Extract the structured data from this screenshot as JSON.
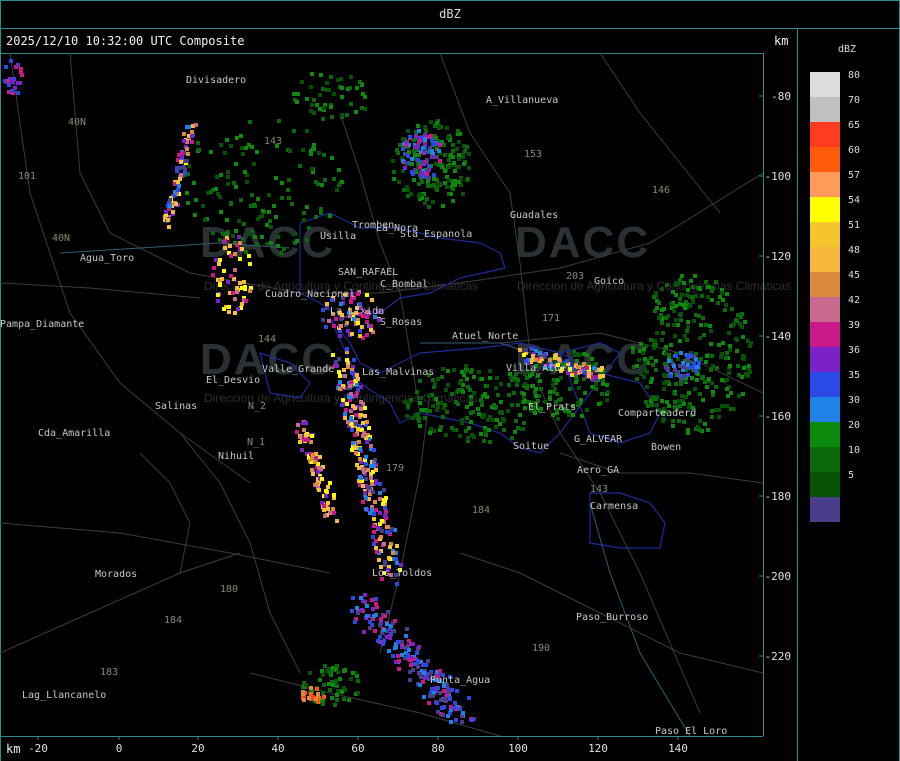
{
  "header": {
    "title": "dBZ"
  },
  "timestamp": "2025/12/10 10:32:00 UTC Composite",
  "units": {
    "top_right": "km",
    "bottom_left": "km"
  },
  "legend": {
    "title": "dBZ",
    "items": [
      {
        "value": "80",
        "color": "#dcdcdc"
      },
      {
        "value": "70",
        "color": "#c0c0c0"
      },
      {
        "value": "65",
        "color": "#ff3b1f"
      },
      {
        "value": "60",
        "color": "#ff5a0a"
      },
      {
        "value": "57",
        "color": "#ff9a5a"
      },
      {
        "value": "54",
        "color": "#ffff00"
      },
      {
        "value": "51",
        "color": "#f5c52e"
      },
      {
        "value": "48",
        "color": "#f5b83a"
      },
      {
        "value": "45",
        "color": "#d98a3a"
      },
      {
        "value": "42",
        "color": "#c86a90"
      },
      {
        "value": "39",
        "color": "#c8188a"
      },
      {
        "value": "36",
        "color": "#7a22c8"
      },
      {
        "value": "35",
        "color": "#2a4ae6"
      },
      {
        "value": "30",
        "color": "#1e82e6"
      },
      {
        "value": "20",
        "color": "#0c8a0c"
      },
      {
        "value": "10",
        "color": "#0a6a0a"
      },
      {
        "value": "5",
        "color": "#055205"
      },
      {
        "value": "",
        "color": "#4a3e8a"
      }
    ]
  },
  "x_axis": {
    "ticks": [
      "-20",
      "0",
      "20",
      "40",
      "60",
      "80",
      "100",
      "120",
      "140"
    ]
  },
  "y_axis": {
    "ticks": [
      "-80",
      "-100",
      "-120",
      "-140",
      "-160",
      "-180",
      "-200",
      "-220"
    ]
  },
  "places": [
    {
      "name": "Divisadero"
    },
    {
      "name": "A_Villanueva"
    },
    {
      "name": "Guadales"
    },
    {
      "name": "Agua_Toro"
    },
    {
      "name": "Pampa_Diamante"
    },
    {
      "name": "El_Desvio"
    },
    {
      "name": "Salinas"
    },
    {
      "name": "Cda_Amarilla"
    },
    {
      "name": "Nihuil"
    },
    {
      "name": "Morados"
    },
    {
      "name": "Lag_Llancanelo"
    },
    {
      "name": "Soitue"
    },
    {
      "name": "Bowen"
    },
    {
      "name": "Carmensa"
    },
    {
      "name": "Paso_Burroso"
    },
    {
      "name": "Paso_El_Loro"
    },
    {
      "name": "Goico"
    },
    {
      "name": "Comparteaderd"
    },
    {
      "name": "Valle_Grande"
    },
    {
      "name": "Las_Malvinas"
    },
    {
      "name": "S_Rosas"
    },
    {
      "name": "Atuel_Norte"
    },
    {
      "name": "El_Prats"
    },
    {
      "name": "G_ALVEAR"
    },
    {
      "name": "Aero_GA"
    },
    {
      "name": "Los_Toldos"
    },
    {
      "name": "Punta_Agua"
    },
    {
      "name": "SAN_RAFAEL"
    },
    {
      "name": "C_Bombal"
    },
    {
      "name": "Usilla"
    },
    {
      "name": "La_Nora"
    },
    {
      "name": "Cuadro_Nacional"
    },
    {
      "name": "Sta_Espanola"
    },
    {
      "name": "Tromben"
    },
    {
      "name": "Villa_Atuel"
    },
    {
      "name": "La_Lixida"
    }
  ],
  "routes": [
    {
      "name": "40N"
    },
    {
      "name": "40N"
    },
    {
      "name": "101"
    },
    {
      "name": "143"
    },
    {
      "name": "153"
    },
    {
      "name": "146"
    },
    {
      "name": "171"
    },
    {
      "name": "179"
    },
    {
      "name": "184"
    },
    {
      "name": "180"
    },
    {
      "name": "184"
    },
    {
      "name": "183"
    },
    {
      "name": "190"
    },
    {
      "name": "143"
    },
    {
      "name": "203"
    },
    {
      "name": "144"
    },
    {
      "name": "N_2"
    },
    {
      "name": "N_1"
    }
  ],
  "watermarks": [
    {
      "brand": "DACC",
      "sub": "Direccion de Agricultura y Contingencias Climaticas"
    }
  ]
}
